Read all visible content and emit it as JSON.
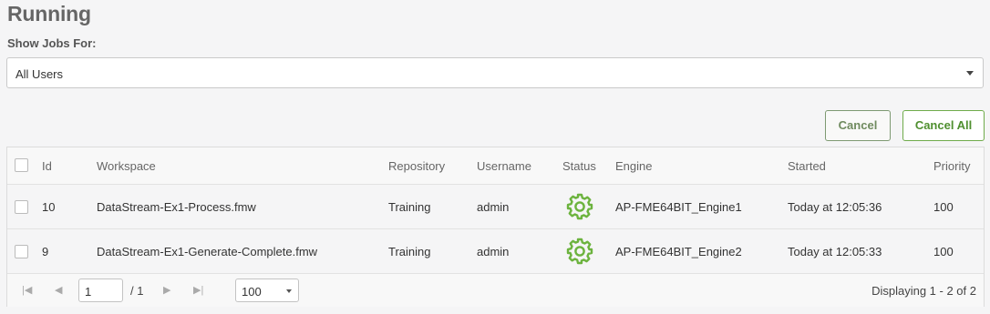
{
  "page": {
    "title": "Running",
    "show_jobs_label": "Show Jobs For:"
  },
  "filter": {
    "selected": "All Users"
  },
  "actions": {
    "cancel_label": "Cancel",
    "cancel_all_label": "Cancel All"
  },
  "table": {
    "headers": {
      "id": "Id",
      "workspace": "Workspace",
      "repository": "Repository",
      "username": "Username",
      "status": "Status",
      "engine": "Engine",
      "started": "Started",
      "priority": "Priority"
    },
    "rows": [
      {
        "id": "10",
        "workspace": "DataStream-Ex1-Process.fmw",
        "repository": "Training",
        "username": "admin",
        "status": "gear-icon",
        "engine": "AP-FME64BIT_Engine1",
        "started": "Today at 12:05:36",
        "priority": "100"
      },
      {
        "id": "9",
        "workspace": "DataStream-Ex1-Generate-Complete.fmw",
        "repository": "Training",
        "username": "admin",
        "status": "gear-icon",
        "engine": "AP-FME64BIT_Engine2",
        "started": "Today at 12:05:33",
        "priority": "100"
      }
    ]
  },
  "pager": {
    "current_page": "1",
    "total_pages": "/ 1",
    "page_size": "100",
    "displaying": "Displaying 1 - 2 of 2"
  },
  "colors": {
    "accent": "#6fab4a",
    "gear": "#6cb33e"
  }
}
